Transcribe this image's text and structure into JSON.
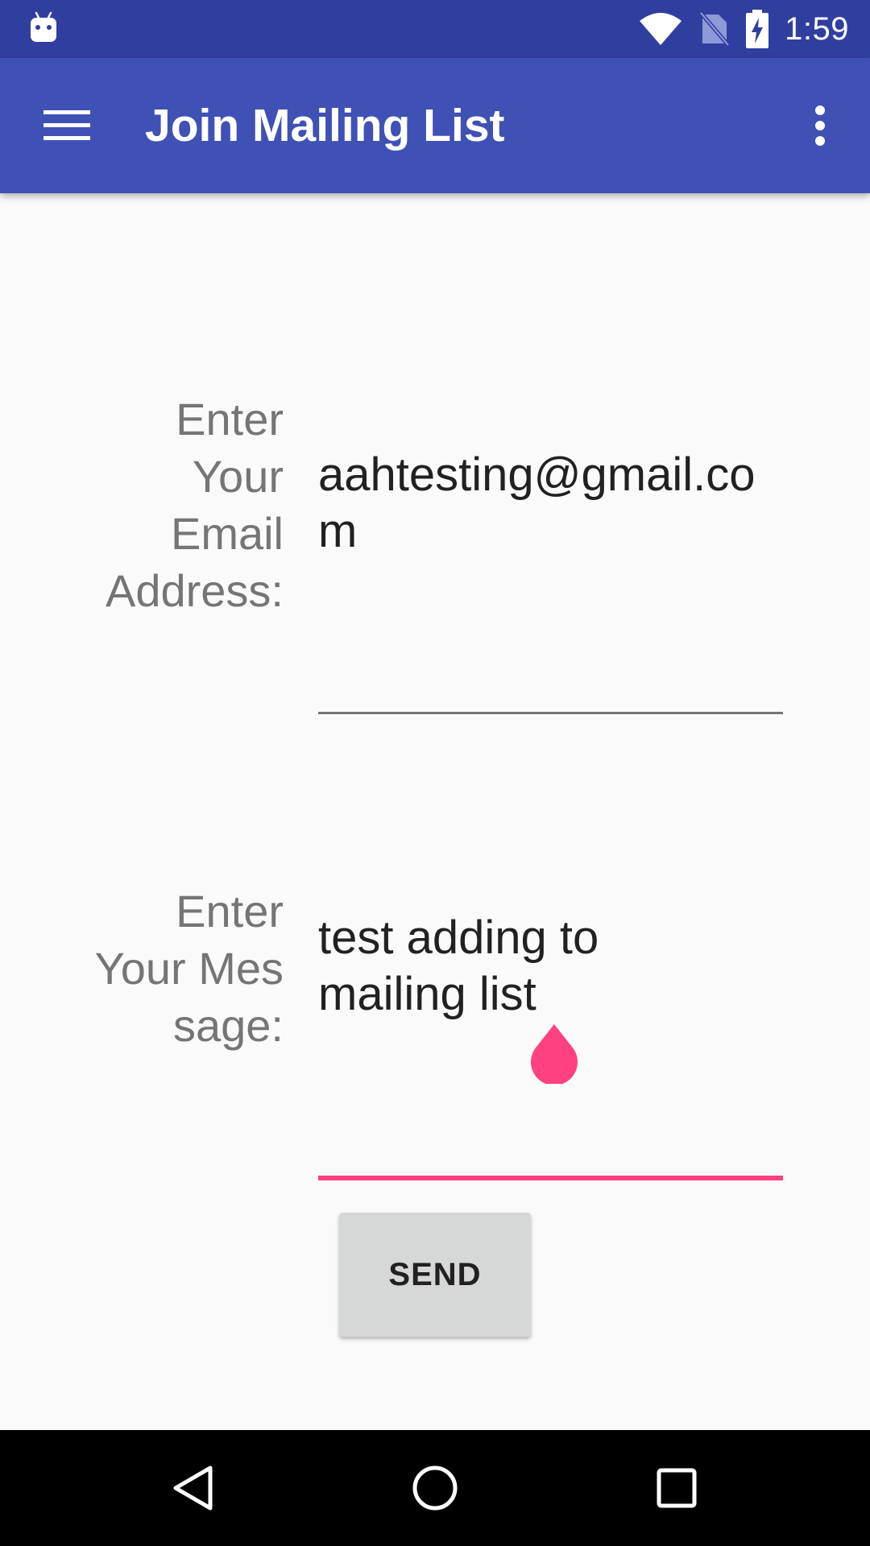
{
  "status_bar": {
    "time": "1:59",
    "icons": [
      "android-notification-icon",
      "wifi-icon",
      "no-sim-icon",
      "battery-charging-icon"
    ]
  },
  "app_bar": {
    "title": "Join Mailing List",
    "nav_icon": "hamburger-menu-icon",
    "overflow_icon": "more-vert-icon"
  },
  "form": {
    "email_label": "Enter\nYour\nEmail\nAddress:",
    "email_value": "aahtesting@gmail.com",
    "message_label": "Enter\nYour Mes\nsage:",
    "message_value": "test adding to\nmailing list",
    "send_label": "SEND"
  },
  "colors": {
    "status_bar": "#303f9f",
    "app_bar": "#3f51b5",
    "accent": "#ff4081",
    "button": "#d6d7d7",
    "label_text": "#757575",
    "input_text": "#212121"
  },
  "nav_bar": {
    "icons": [
      "back-icon",
      "home-icon",
      "recents-icon"
    ]
  }
}
